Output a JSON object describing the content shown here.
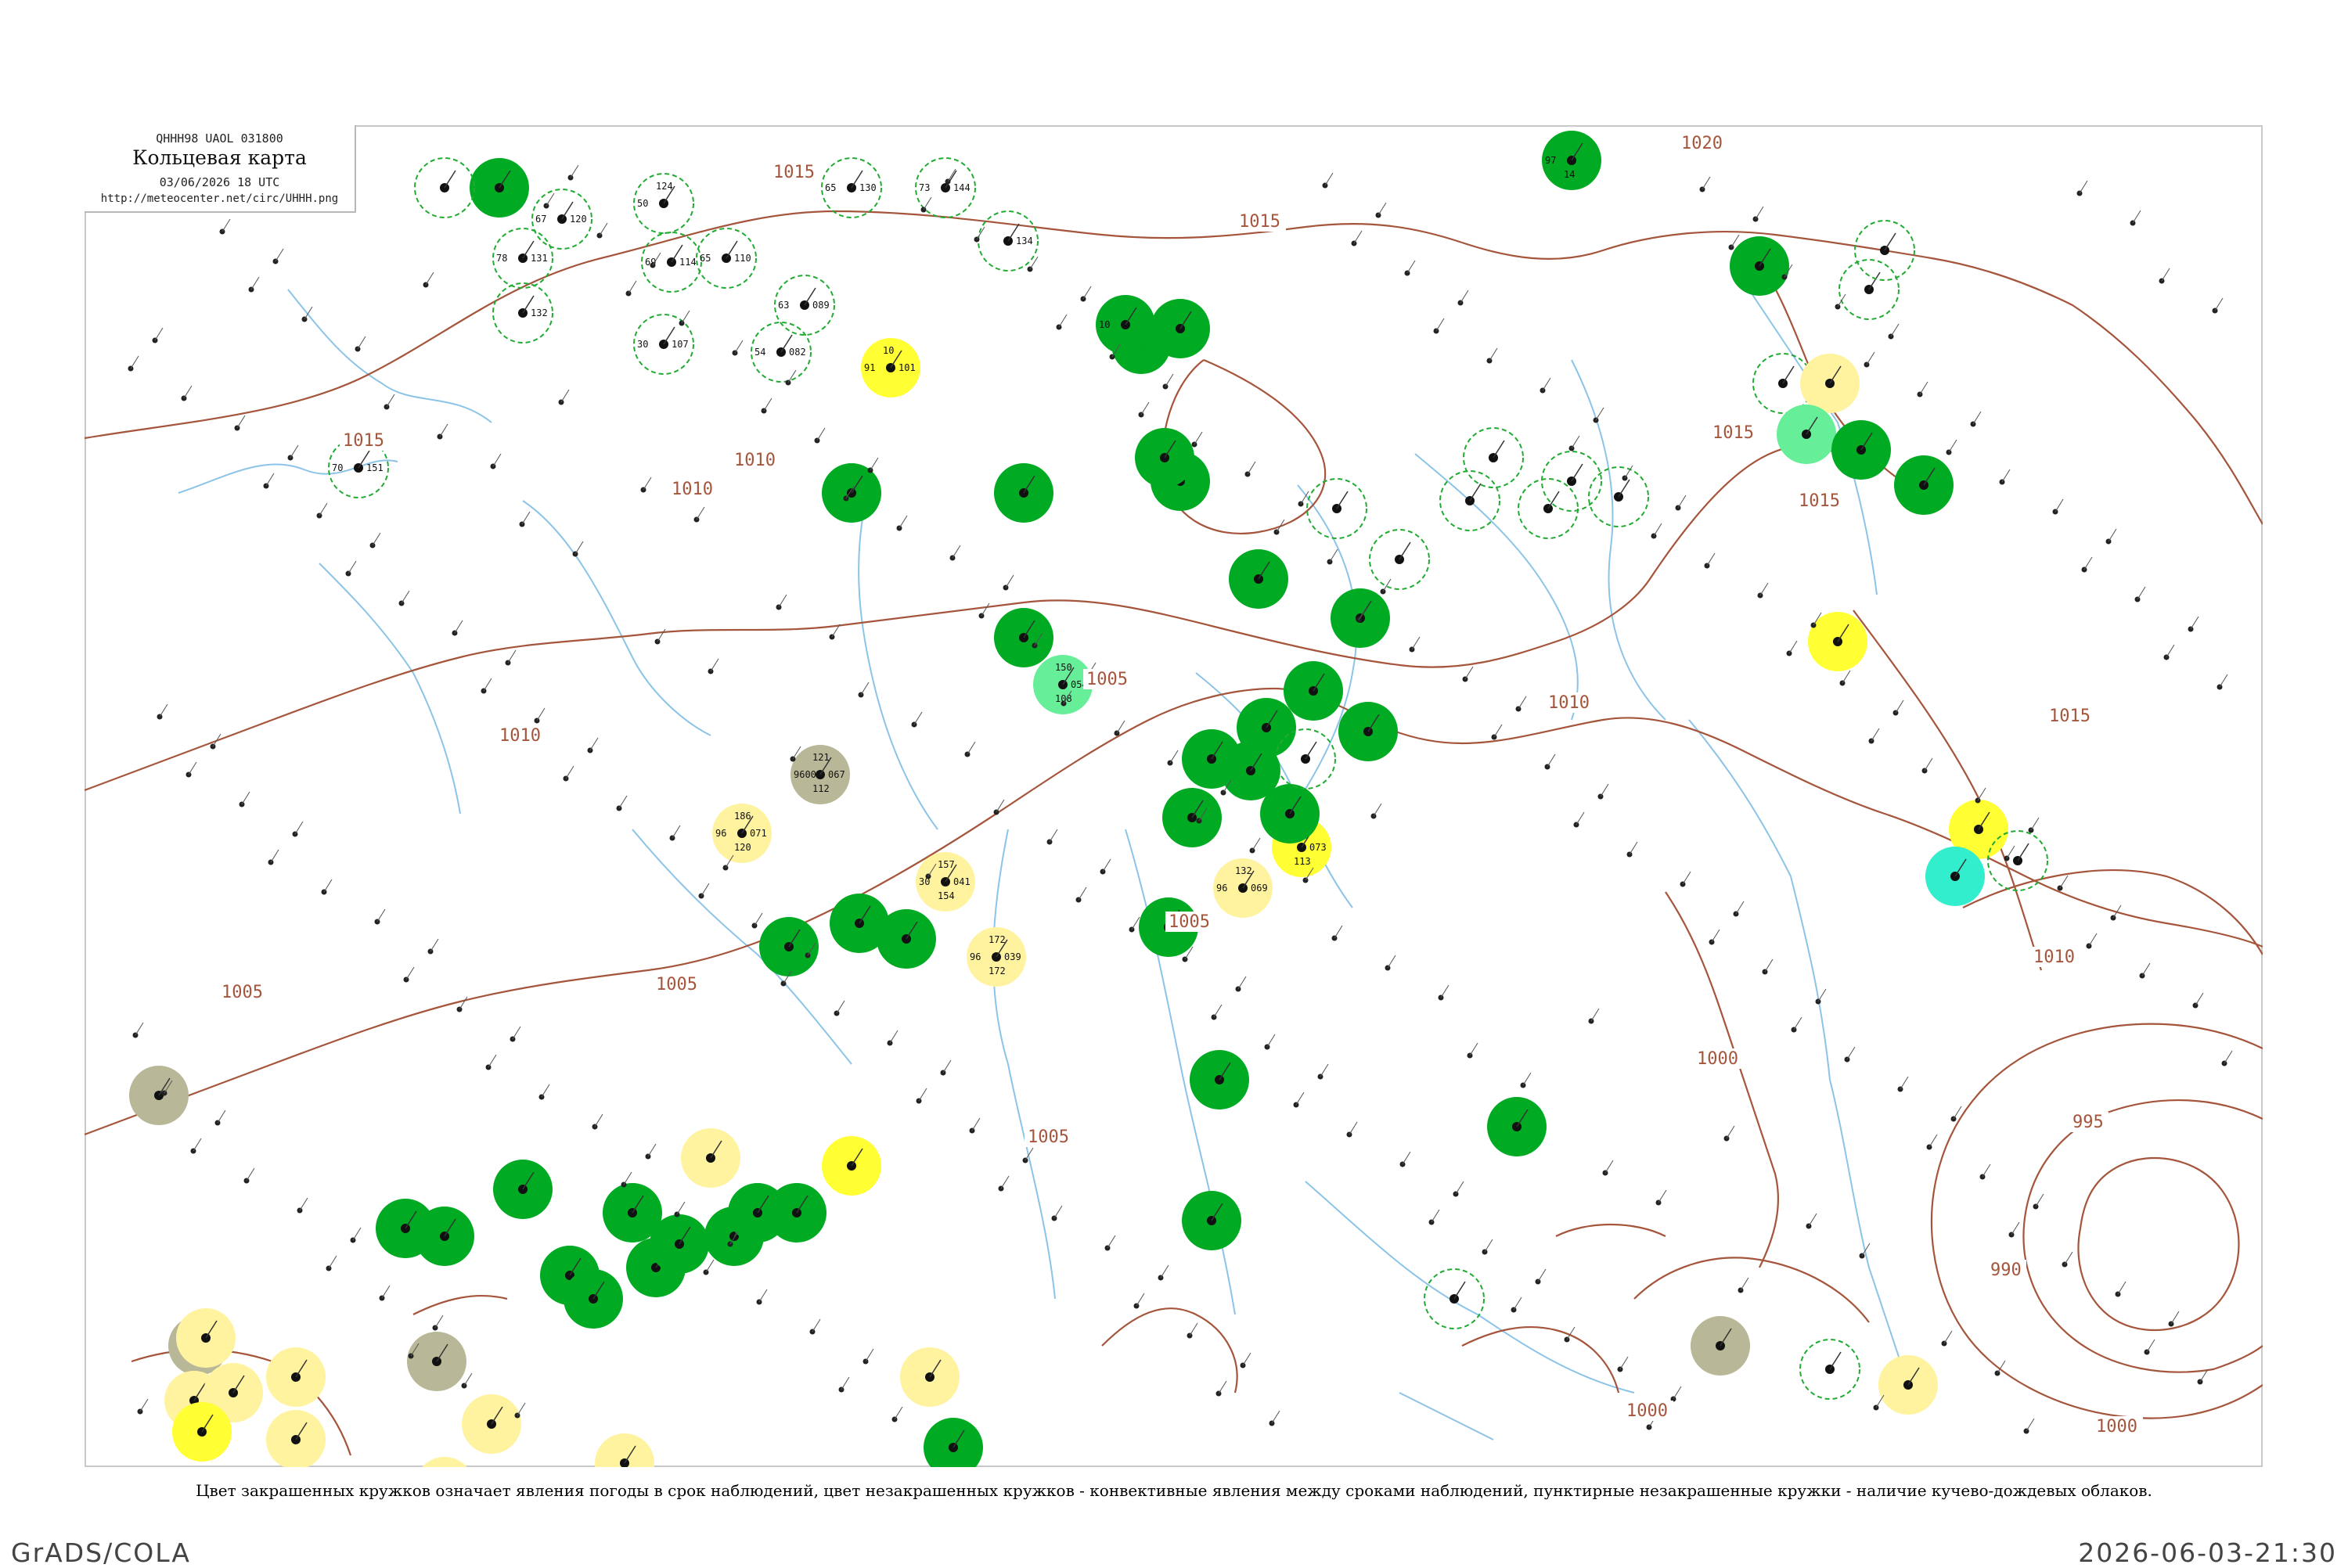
{
  "header": {
    "code": "QHHH98  UAOL  031800",
    "title": "Кольцевая карта",
    "datetime": "03/06/2026 18 UTC",
    "url": "http://meteocenter.net/circ/UHHH.png"
  },
  "caption": "Цвет закрашенных кружков означает явления погоды в срок наблюдений, цвет незакрашенных кружков - конвективные явления между сроками наблюдений, пунктирные незакрашенные кружки - наличие кучево-дождевых облаков.",
  "footer": {
    "left": "GrADS/COLA",
    "right": "2026-06-03-21:30"
  },
  "colors": {
    "isobar": "#a5553b",
    "river": "#8cc4e8",
    "frame": "#c8c8c8",
    "rain": "#00aa22",
    "rain_light": "#66ee99",
    "haze": "#fff3a0",
    "mist": "#ffff33",
    "smoke": "#b8b898",
    "cyan": "#33eecc",
    "cb_dash": "#22aa33"
  },
  "isobar_labels": [
    "1020",
    "1015",
    "1015",
    "1015",
    "1015",
    "1015",
    "1015",
    "1010",
    "1010",
    "1010",
    "1010",
    "1010",
    "1005",
    "1005",
    "1005",
    "1005",
    "1005",
    "1000",
    "1000",
    "1000",
    "995",
    "990"
  ],
  "stations": [
    {
      "kind": "rain",
      "top": "",
      "left": "97",
      "right": "",
      "bottom": "14",
      "id": ""
    },
    {
      "kind": "rain",
      "top": "",
      "left": "",
      "right": "",
      "bottom": "",
      "id": ""
    },
    {
      "kind": "cb",
      "top": "",
      "left": "",
      "right": "",
      "bottom": "",
      "id": ""
    },
    {
      "kind": "cb",
      "top": "",
      "left": "67",
      "right": "120",
      "bottom": "",
      "id": ""
    },
    {
      "kind": "cb",
      "top": "124",
      "left": "50",
      "right": "",
      "bottom": "",
      "id": ""
    },
    {
      "kind": "cb",
      "top": "",
      "left": "78",
      "right": "131",
      "bottom": "",
      "id": ""
    },
    {
      "kind": "cb",
      "top": "",
      "left": "69",
      "right": "114",
      "bottom": "",
      "id": ""
    },
    {
      "kind": "cb",
      "top": "",
      "left": "65",
      "right": "110",
      "bottom": "",
      "id": ""
    },
    {
      "kind": "cb",
      "top": "",
      "left": "",
      "right": "132",
      "bottom": "",
      "id": ""
    },
    {
      "kind": "cb",
      "top": "",
      "left": "30",
      "right": "107",
      "bottom": "",
      "id": ""
    },
    {
      "kind": "cb",
      "top": "",
      "left": "65",
      "right": "130",
      "bottom": "",
      "id": ""
    },
    {
      "kind": "cb",
      "top": "",
      "left": "73",
      "right": "144",
      "bottom": "",
      "id": ""
    },
    {
      "kind": "cb",
      "top": "",
      "left": "",
      "right": "134",
      "bottom": "",
      "id": ""
    },
    {
      "kind": "cb",
      "top": "",
      "left": "63",
      "right": "089",
      "bottom": "",
      "id": ""
    },
    {
      "kind": "cb",
      "top": "",
      "left": "54",
      "right": "082",
      "bottom": "",
      "id": ""
    },
    {
      "kind": "cb",
      "top": "",
      "left": "70",
      "right": "151",
      "bottom": "",
      "id": ""
    },
    {
      "kind": "mist",
      "top": "10",
      "left": "91",
      "right": "101",
      "bottom": "",
      "id": ""
    },
    {
      "kind": "rain",
      "top": "",
      "left": "",
      "right": "",
      "bottom": "",
      "id": ""
    },
    {
      "kind": "rain",
      "top": "",
      "left": "",
      "right": "",
      "bottom": "",
      "id": ""
    },
    {
      "kind": "rain",
      "top": "",
      "left": "",
      "right": "",
      "bottom": "",
      "id": ""
    },
    {
      "kind": "rain",
      "top": "",
      "left": "10",
      "right": "",
      "bottom": "",
      "id": ""
    },
    {
      "kind": "rain",
      "top": "",
      "left": "",
      "right": "",
      "bottom": "",
      "id": ""
    },
    {
      "kind": "rain",
      "top": "",
      "left": "",
      "right": "",
      "bottom": "",
      "id": ""
    },
    {
      "kind": "rain_light",
      "top": "150",
      "left": "",
      "right": "054",
      "bottom": "108",
      "id": ""
    },
    {
      "kind": "smoke",
      "top": "121",
      "left": "9600",
      "right": "067",
      "bottom": "112",
      "id": ""
    },
    {
      "kind": "haze",
      "top": "186",
      "left": "96",
      "right": "071",
      "bottom": "120",
      "id": ""
    },
    {
      "kind": "haze",
      "top": "157",
      "left": "30",
      "right": "041",
      "bottom": "154",
      "id": ""
    },
    {
      "kind": "haze",
      "top": "172",
      "left": "96",
      "right": "039",
      "bottom": "172",
      "id": ""
    },
    {
      "kind": "mist",
      "top": "113",
      "left": "",
      "right": "073",
      "bottom": "113",
      "id": ""
    },
    {
      "kind": "haze",
      "top": "132",
      "left": "96",
      "right": "069",
      "bottom": "",
      "id": ""
    },
    {
      "kind": "rain",
      "top": "",
      "left": "",
      "right": "",
      "bottom": "",
      "id": ""
    },
    {
      "kind": "rain",
      "top": "",
      "left": "",
      "right": "",
      "bottom": "",
      "id": ""
    },
    {
      "kind": "rain",
      "top": "",
      "left": "",
      "right": "",
      "bottom": "",
      "id": ""
    },
    {
      "kind": "rain",
      "top": "",
      "left": "",
      "right": "",
      "bottom": "",
      "id": ""
    },
    {
      "kind": "rain",
      "top": "",
      "left": "",
      "right": "",
      "bottom": "",
      "id": ""
    },
    {
      "kind": "rain",
      "top": "",
      "left": "",
      "right": "",
      "bottom": "",
      "id": ""
    },
    {
      "kind": "rain",
      "top": "",
      "left": "",
      "right": "",
      "bottom": "",
      "id": ""
    },
    {
      "kind": "rain",
      "top": "",
      "left": "",
      "right": "",
      "bottom": "",
      "id": ""
    },
    {
      "kind": "rain",
      "top": "",
      "left": "",
      "right": "",
      "bottom": "",
      "id": ""
    },
    {
      "kind": "rain",
      "top": "",
      "left": "",
      "right": "",
      "bottom": "",
      "id": ""
    },
    {
      "kind": "rain",
      "top": "",
      "left": "",
      "right": "",
      "bottom": "",
      "id": ""
    },
    {
      "kind": "rain",
      "top": "",
      "left": "",
      "right": "",
      "bottom": "",
      "id": ""
    },
    {
      "kind": "rain",
      "top": "",
      "left": "",
      "right": "",
      "bottom": "",
      "id": ""
    },
    {
      "kind": "rain",
      "top": "",
      "left": "",
      "right": "",
      "bottom": "",
      "id": ""
    },
    {
      "kind": "rain",
      "top": "",
      "left": "",
      "right": "",
      "bottom": "",
      "id": ""
    },
    {
      "kind": "rain",
      "top": "",
      "left": "",
      "right": "",
      "bottom": "",
      "id": ""
    },
    {
      "kind": "rain",
      "top": "",
      "left": "",
      "right": "",
      "bottom": "",
      "id": ""
    },
    {
      "kind": "rain",
      "top": "",
      "left": "",
      "right": "",
      "bottom": "",
      "id": ""
    },
    {
      "kind": "rain",
      "top": "",
      "left": "",
      "right": "",
      "bottom": "",
      "id": ""
    },
    {
      "kind": "rain",
      "top": "",
      "left": "",
      "right": "",
      "bottom": "",
      "id": ""
    },
    {
      "kind": "rain",
      "top": "",
      "left": "",
      "right": "",
      "bottom": "",
      "id": ""
    },
    {
      "kind": "rain",
      "top": "",
      "left": "",
      "right": "",
      "bottom": "",
      "id": ""
    },
    {
      "kind": "rain",
      "top": "",
      "left": "",
      "right": "",
      "bottom": "",
      "id": ""
    },
    {
      "kind": "rain",
      "top": "",
      "left": "",
      "right": "",
      "bottom": "",
      "id": ""
    },
    {
      "kind": "rain",
      "top": "",
      "left": "",
      "right": "",
      "bottom": "",
      "id": ""
    },
    {
      "kind": "rain",
      "top": "",
      "left": "",
      "right": "",
      "bottom": "",
      "id": ""
    },
    {
      "kind": "rain",
      "top": "",
      "left": "",
      "right": "",
      "bottom": "",
      "id": ""
    },
    {
      "kind": "cb",
      "top": "",
      "left": "",
      "right": "",
      "bottom": "",
      "id": ""
    },
    {
      "kind": "cb",
      "top": "",
      "left": "",
      "right": "",
      "bottom": "",
      "id": ""
    },
    {
      "kind": "cb",
      "top": "",
      "left": "",
      "right": "",
      "bottom": "",
      "id": ""
    },
    {
      "kind": "rain",
      "top": "",
      "left": "",
      "right": "",
      "bottom": "",
      "id": ""
    },
    {
      "kind": "rain",
      "top": "",
      "left": "",
      "right": "",
      "bottom": "",
      "id": ""
    },
    {
      "kind": "rain",
      "top": "",
      "left": "",
      "right": "",
      "bottom": "",
      "id": ""
    },
    {
      "kind": "cb",
      "top": "",
      "left": "",
      "right": "",
      "bottom": "",
      "id": ""
    },
    {
      "kind": "cb",
      "top": "",
      "left": "",
      "right": "",
      "bottom": "",
      "id": ""
    },
    {
      "kind": "cb",
      "top": "",
      "left": "",
      "right": "",
      "bottom": "",
      "id": ""
    },
    {
      "kind": "cb",
      "top": "",
      "left": "",
      "right": "",
      "bottom": "",
      "id": ""
    },
    {
      "kind": "cb",
      "top": "",
      "left": "",
      "right": "",
      "bottom": "",
      "id": ""
    },
    {
      "kind": "rain",
      "top": "",
      "left": "",
      "right": "",
      "bottom": "",
      "id": ""
    },
    {
      "kind": "cb",
      "top": "",
      "left": "",
      "right": "",
      "bottom": "",
      "id": ""
    },
    {
      "kind": "cb",
      "top": "",
      "left": "",
      "right": "",
      "bottom": "",
      "id": ""
    },
    {
      "kind": "cb",
      "top": "",
      "left": "",
      "right": "",
      "bottom": "",
      "id": ""
    },
    {
      "kind": "haze",
      "top": "",
      "left": "",
      "right": "",
      "bottom": "",
      "id": ""
    },
    {
      "kind": "rain_light",
      "top": "",
      "left": "",
      "right": "",
      "bottom": "",
      "id": ""
    },
    {
      "kind": "rain",
      "top": "",
      "left": "",
      "right": "",
      "bottom": "",
      "id": ""
    },
    {
      "kind": "rain",
      "top": "",
      "left": "",
      "right": "",
      "bottom": "",
      "id": ""
    },
    {
      "kind": "mist",
      "top": "",
      "left": "",
      "right": "",
      "bottom": "",
      "id": ""
    },
    {
      "kind": "mist",
      "top": "",
      "left": "",
      "right": "",
      "bottom": "",
      "id": ""
    },
    {
      "kind": "cyan",
      "top": "",
      "left": "",
      "right": "",
      "bottom": "",
      "id": ""
    },
    {
      "kind": "cb",
      "top": "",
      "left": "",
      "right": "",
      "bottom": "",
      "id": ""
    },
    {
      "kind": "cb",
      "top": "",
      "left": "",
      "right": "",
      "bottom": "",
      "id": ""
    },
    {
      "kind": "smoke",
      "top": "",
      "left": "",
      "right": "",
      "bottom": "",
      "id": ""
    },
    {
      "kind": "smoke",
      "top": "",
      "left": "",
      "right": "",
      "bottom": "",
      "id": ""
    },
    {
      "kind": "smoke",
      "top": "",
      "left": "",
      "right": "",
      "bottom": "",
      "id": ""
    },
    {
      "kind": "smoke",
      "top": "",
      "left": "",
      "right": "",
      "bottom": "",
      "id": ""
    },
    {
      "kind": "haze",
      "top": "",
      "left": "",
      "right": "",
      "bottom": "",
      "id": ""
    },
    {
      "kind": "haze",
      "top": "",
      "left": "",
      "right": "",
      "bottom": "",
      "id": ""
    },
    {
      "kind": "haze",
      "top": "",
      "left": "",
      "right": "",
      "bottom": "",
      "id": ""
    },
    {
      "kind": "haze",
      "top": "",
      "left": "",
      "right": "",
      "bottom": "",
      "id": ""
    },
    {
      "kind": "haze",
      "top": "",
      "left": "",
      "right": "",
      "bottom": "",
      "id": ""
    },
    {
      "kind": "haze",
      "top": "",
      "left": "",
      "right": "",
      "bottom": "",
      "id": ""
    },
    {
      "kind": "haze",
      "top": "",
      "left": "",
      "right": "",
      "bottom": "",
      "id": ""
    },
    {
      "kind": "haze",
      "top": "",
      "left": "",
      "right": "",
      "bottom": "",
      "id": ""
    },
    {
      "kind": "haze",
      "top": "",
      "left": "",
      "right": "",
      "bottom": "",
      "id": ""
    },
    {
      "kind": "haze",
      "top": "",
      "left": "",
      "right": "",
      "bottom": "",
      "id": ""
    },
    {
      "kind": "haze",
      "top": "",
      "left": "",
      "right": "",
      "bottom": "",
      "id": ""
    },
    {
      "kind": "mist",
      "top": "",
      "left": "",
      "right": "",
      "bottom": "",
      "id": ""
    },
    {
      "kind": "mist",
      "top": "",
      "left": "",
      "right": "",
      "bottom": "",
      "id": ""
    },
    {
      "kind": "mist",
      "top": "",
      "left": "",
      "right": "",
      "bottom": "",
      "id": ""
    },
    {
      "kind": "haze",
      "top": "",
      "left": "",
      "right": "",
      "bottom": "",
      "id": ""
    },
    {
      "kind": "cb",
      "top": "",
      "left": "",
      "right": "",
      "bottom": "",
      "id": ""
    },
    {
      "kind": "dot",
      "top": "",
      "left": "",
      "right": "",
      "bottom": "",
      "id": ""
    }
  ]
}
